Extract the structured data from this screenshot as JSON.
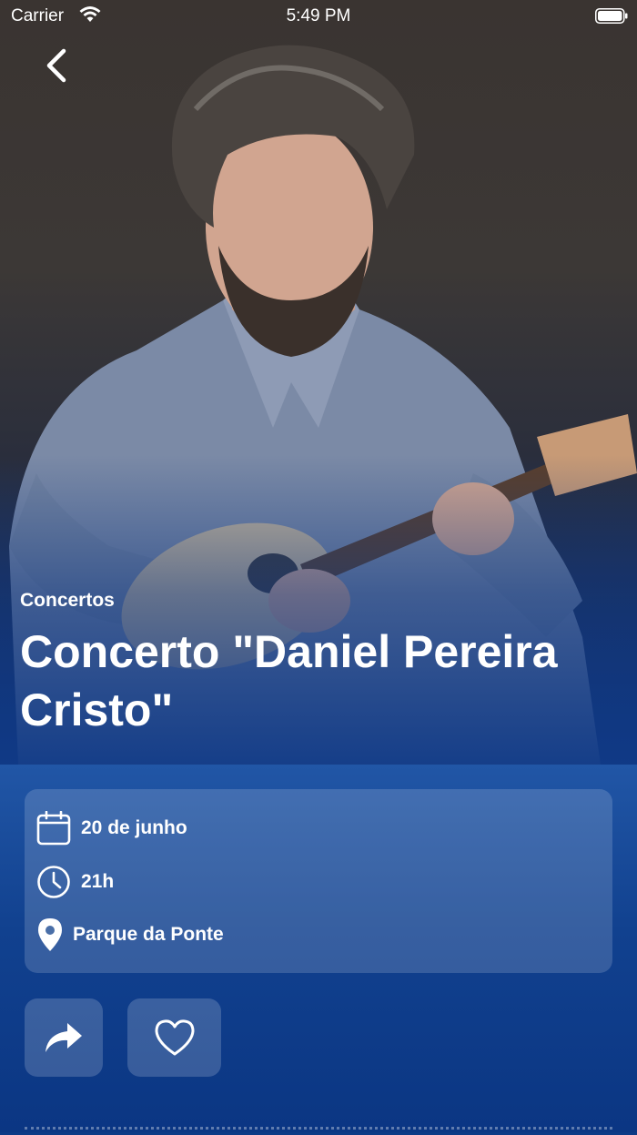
{
  "status_bar": {
    "carrier": "Carrier",
    "time": "5:49 PM",
    "icons": [
      "wifi-icon",
      "battery-icon"
    ]
  },
  "nav": {
    "back_icon": "chevron-left-icon"
  },
  "event": {
    "category": "Concertos",
    "title": "Concerto \"Daniel Pereira Cristo\"",
    "date": "20 de junho",
    "time": "21h",
    "location": "Parque da Ponte"
  },
  "info_icons": {
    "date": "calendar-icon",
    "time": "clock-icon",
    "location": "location-pin-icon"
  },
  "actions": {
    "share_icon": "share-icon",
    "favorite_icon": "heart-icon"
  },
  "colors": {
    "accent": "#11418f",
    "card": "#4b72ad",
    "text": "#ffffff"
  }
}
